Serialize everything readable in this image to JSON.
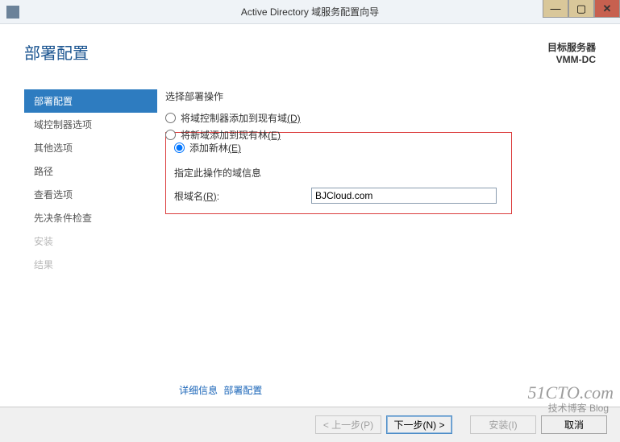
{
  "titlebar": {
    "title": "Active Directory 域服务配置向导"
  },
  "header": {
    "title": "部署配置",
    "target_label": "目标服务器",
    "target_name": "VMM-DC"
  },
  "sidebar": {
    "items": [
      {
        "label": "部署配置",
        "state": "active"
      },
      {
        "label": "域控制器选项",
        "state": "normal"
      },
      {
        "label": "其他选项",
        "state": "normal"
      },
      {
        "label": "路径",
        "state": "normal"
      },
      {
        "label": "查看选项",
        "state": "normal"
      },
      {
        "label": "先决条件检查",
        "state": "normal"
      },
      {
        "label": "安装",
        "state": "disabled"
      },
      {
        "label": "结果",
        "state": "disabled"
      }
    ]
  },
  "form": {
    "section1_label": "选择部署操作",
    "radio_options": [
      {
        "text": "将域控制器添加到现有域",
        "accel": "(D)",
        "checked": false
      },
      {
        "text": "将新域添加到现有林",
        "accel": "(E)",
        "checked": false
      },
      {
        "text": "添加新林",
        "accel": "(E)",
        "checked": true
      }
    ],
    "section2_label": "指定此操作的域信息",
    "root_domain_label": "根域名",
    "root_domain_accel": "(R)",
    "root_domain_value": "BJCloud.com"
  },
  "more_link": {
    "text1": "详细信息",
    "text2": "部署配置"
  },
  "footer": {
    "prev": "< 上一步(P)",
    "next": "下一步(N) >",
    "install": "安装(I)",
    "cancel": "取消"
  },
  "watermark": {
    "main": "51CTO.com",
    "sub": "技术博客  Blog"
  }
}
